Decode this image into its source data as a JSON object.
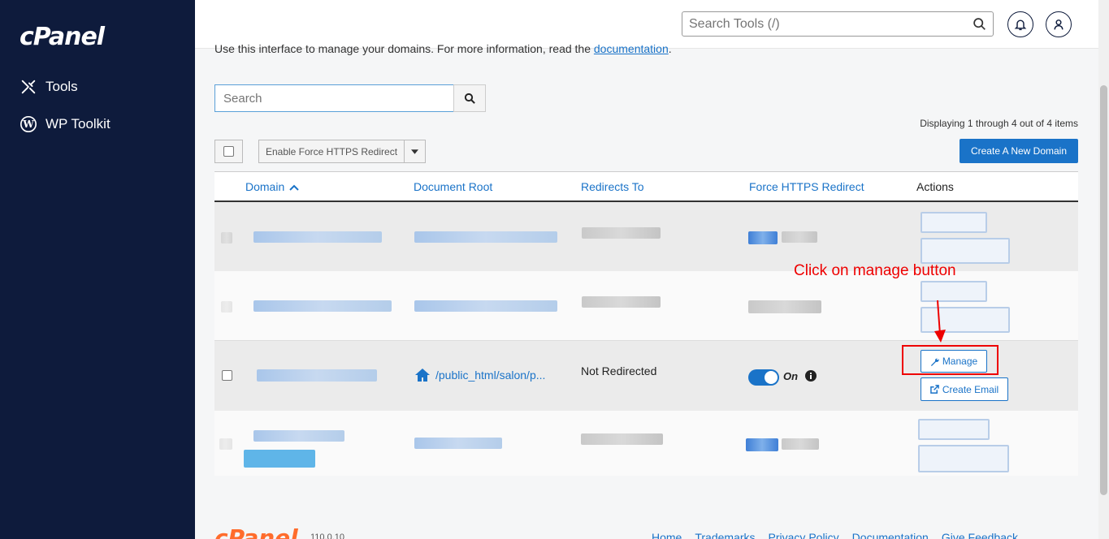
{
  "sidebar": {
    "logo": "cPanel",
    "items": [
      {
        "label": "Tools",
        "icon": "tools-icon"
      },
      {
        "label": "WP Toolkit",
        "icon": "wordpress-icon"
      }
    ]
  },
  "header": {
    "search_placeholder": "Search Tools (/)",
    "notifications_icon": "bell-icon",
    "user_icon": "user-icon"
  },
  "intro": {
    "text": "Use this interface to manage your domains. For more information, read the ",
    "link": "documentation",
    "suffix": "."
  },
  "domain_search": {
    "placeholder": "Search"
  },
  "pagination": {
    "displaying": "Displaying 1 through 4 out of 4 items"
  },
  "toolbar": {
    "force_https_label": "Enable Force HTTPS Redirect",
    "create_domain_label": "Create A New Domain"
  },
  "table": {
    "columns": [
      "Domain",
      "Document Root",
      "Redirects To",
      "Force HTTPS Redirect",
      "Actions"
    ],
    "visible_row": {
      "document_root": "/public_html/salon/p...",
      "redirects_to": "Not Redirected",
      "force_https": "On",
      "actions": [
        "Manage",
        "Create Email"
      ]
    }
  },
  "annotation": {
    "text": "Click on manage button"
  },
  "footer": {
    "logo": "cPanel",
    "version": "110.0.10",
    "links": [
      "Home",
      "Trademarks",
      "Privacy Policy",
      "Documentation",
      "Give Feedback"
    ]
  },
  "colors": {
    "sidebar_bg": "#0e1b3c",
    "accent": "#1a73c8",
    "callout": "#ee0000",
    "footer_logo": "#ff6c2c"
  }
}
